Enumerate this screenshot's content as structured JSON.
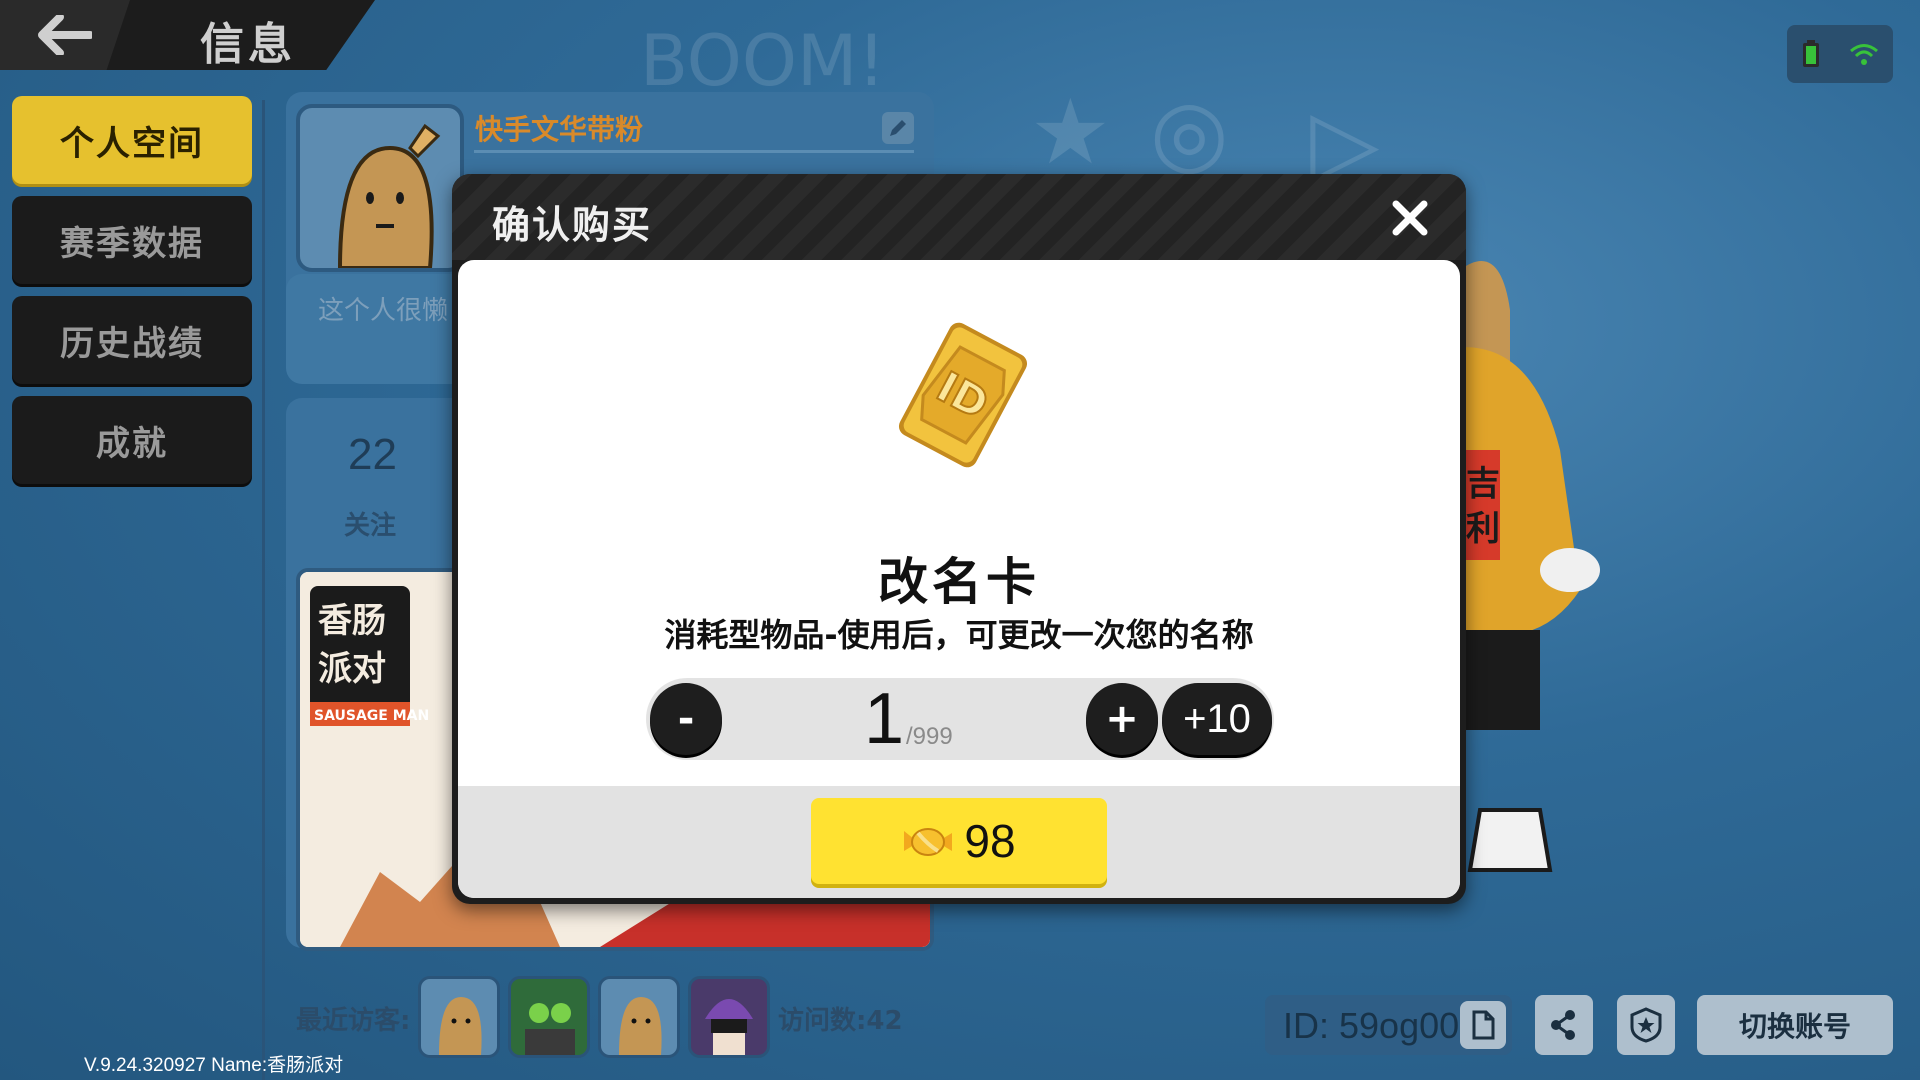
{
  "header": {
    "title": "信息"
  },
  "side_nav": [
    {
      "label": "个人空间",
      "active": true
    },
    {
      "label": "赛季数据",
      "active": false
    },
    {
      "label": "历史战绩",
      "active": false
    },
    {
      "label": "成就",
      "active": false
    }
  ],
  "profile": {
    "username": "快手文华带粉",
    "bio": "这个人很懒",
    "follow_count": "22",
    "follow_label": "关注",
    "banner_logo_text": "SAUSAGE MAN"
  },
  "bottom": {
    "visitors_label": "最近访客:",
    "visit_count": "访问数:42",
    "version": "V.9.24.320927 Name:香肠派对",
    "id": "ID: 59og00",
    "switch_account": "切换账号"
  },
  "modal": {
    "title": "确认购买",
    "item_name": "改名卡",
    "item_desc": "消耗型物品-使用后，可更改一次您的名称",
    "item_icon_text": "ID",
    "quantity": "1",
    "quantity_max": "/999",
    "minus_label": "-",
    "plus_label": "+",
    "plus10_label": "+10",
    "price": "98"
  },
  "colors": {
    "nav_active": "#e6c12e",
    "buy_button": "#ffe231",
    "username": "#d98a2a"
  },
  "icons": [
    "back-arrow-icon",
    "battery-icon",
    "wifi-icon",
    "edit-icon",
    "close-icon",
    "rename-card-icon",
    "candy-currency-icon",
    "copy-icon",
    "share-icon",
    "badge-icon"
  ]
}
